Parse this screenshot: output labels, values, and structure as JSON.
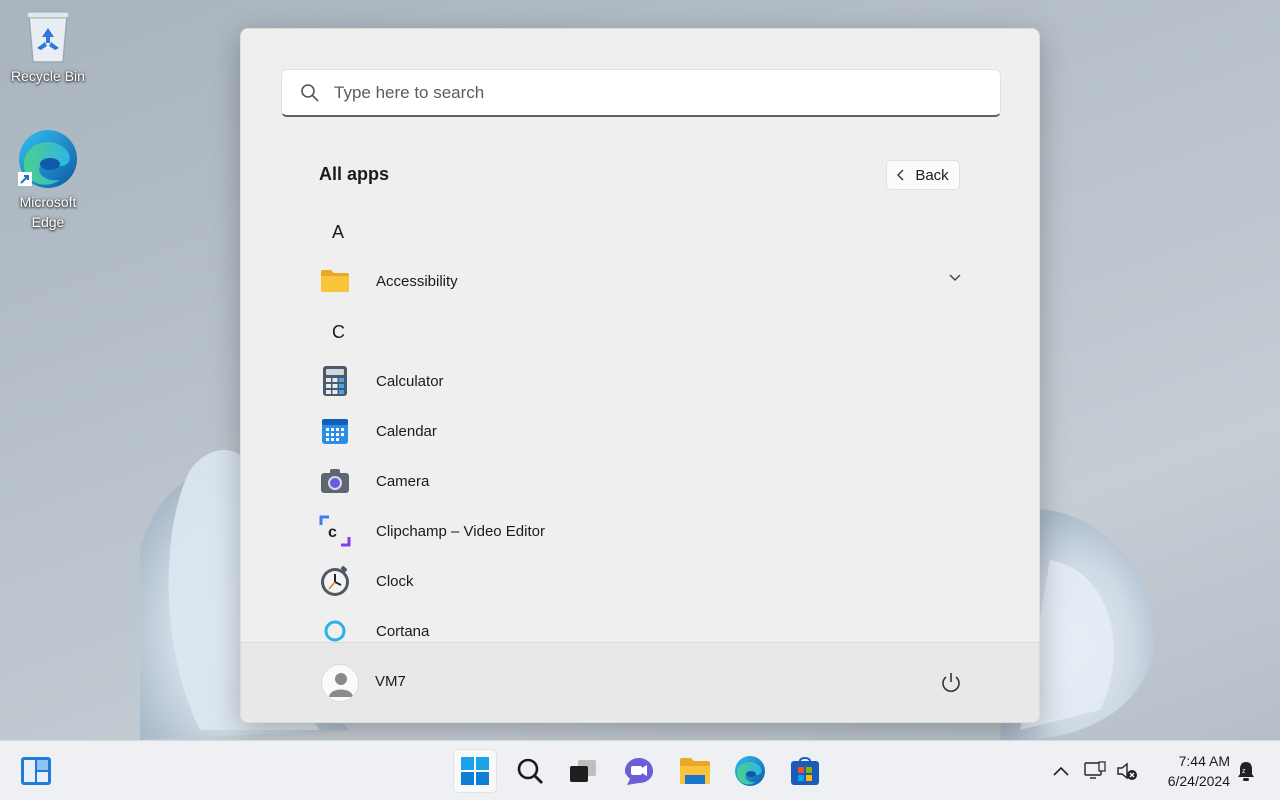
{
  "desktop": {
    "icons": [
      {
        "label": "Recycle Bin",
        "icon": "recycle-bin-icon"
      },
      {
        "label": "Microsoft Edge",
        "icon": "edge-icon"
      }
    ]
  },
  "start_menu": {
    "search": {
      "placeholder": "Type here to search"
    },
    "title": "All apps",
    "back_label": "Back",
    "groups": [
      {
        "letter": "A",
        "apps": [
          {
            "name": "Accessibility",
            "icon": "folder-icon",
            "expandable": true
          }
        ]
      },
      {
        "letter": "C",
        "apps": [
          {
            "name": "Calculator",
            "icon": "calculator-icon"
          },
          {
            "name": "Calendar",
            "icon": "calendar-icon"
          },
          {
            "name": "Camera",
            "icon": "camera-icon"
          },
          {
            "name": "Clipchamp – Video Editor",
            "icon": "clipchamp-icon"
          },
          {
            "name": "Clock",
            "icon": "clock-icon"
          },
          {
            "name": "Cortana",
            "icon": "cortana-icon"
          }
        ]
      }
    ],
    "user": {
      "name": "VM7"
    }
  },
  "taskbar": {
    "items": [
      "widgets",
      "start",
      "search",
      "task-view",
      "chat",
      "file-explorer",
      "edge",
      "store"
    ],
    "time": "7:44 AM",
    "date": "6/24/2024"
  },
  "colors": {
    "accent": "#0078d4",
    "folder": "#f8c43a"
  }
}
